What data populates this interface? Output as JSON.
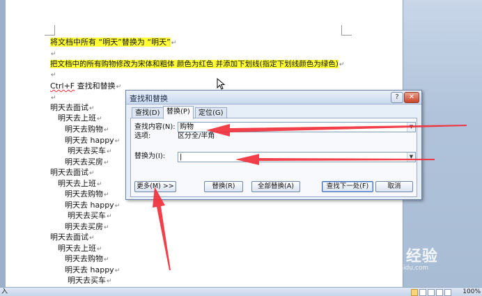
{
  "document": {
    "lines": [
      {
        "text": "将文档中所有 “明天”替换为 “明天”",
        "highlight": true
      },
      {
        "text": "",
        "highlight": false
      },
      {
        "text": "把文档中的所有购物修改为宋体和粗体  颜色为红色 并添加下划线(指定下划线颜色为绿色)",
        "highlight": true
      },
      {
        "text": "",
        "highlight": false
      },
      {
        "text_a": "Ctrl+F",
        "text_b": "  查找和替换"
      },
      {
        "text": ""
      },
      {
        "text": "明天去面试"
      },
      {
        "text": "明天去上班"
      },
      {
        "text": "明天去购物"
      },
      {
        "text": "明天去 happy"
      },
      {
        "text": "明天去买车"
      },
      {
        "text": "明天去买房"
      },
      {
        "text": "明天去面试"
      },
      {
        "text": "明天去上班"
      },
      {
        "text": "明天去购物"
      },
      {
        "text": "明天去 happy"
      },
      {
        "text": "明天去买车"
      },
      {
        "text": "明天去买房"
      },
      {
        "text": "明天去面试"
      },
      {
        "text": "明天去上班"
      },
      {
        "text": "明天去购物"
      },
      {
        "text": "明天去 happy"
      },
      {
        "text": "明天去买车"
      }
    ],
    "paragraph_mark": "↵"
  },
  "dialog": {
    "title": "查找和替换",
    "help_label": "?",
    "close_label": "✕",
    "tabs": [
      "查找(D)",
      "替换(P)",
      "定位(G)"
    ],
    "active_tab": 1,
    "find_label": "查找内容(N):",
    "find_value": "购物",
    "options_label": "选项:",
    "options_value": "区分全/半角",
    "replace_label": "替换为(I):",
    "replace_value": "|",
    "buttons": {
      "more": "更多(M) >>",
      "replace": "替换(R)",
      "replace_all": "全部替换(A)",
      "find_next": "查找下一处(F)",
      "cancel": "取消"
    }
  },
  "status_bar": {
    "left_text": "入",
    "zoom": "100%"
  },
  "watermark": {
    "brand": "Bai  经验",
    "url": "jingyan.baidu.com"
  },
  "colors": {
    "highlight": "#ffff33",
    "annotation_arrow": "#f0303a",
    "dialog_bg": "#e6eef8"
  }
}
